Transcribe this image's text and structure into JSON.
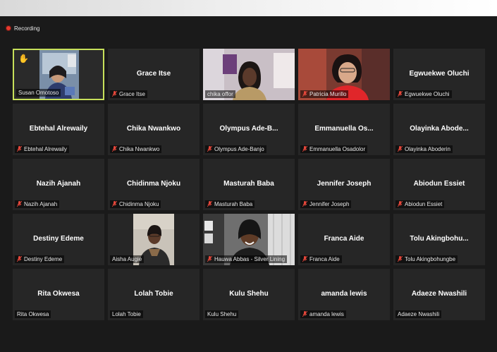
{
  "recording": {
    "label": "Recording"
  },
  "participants": [
    {
      "id": "t0",
      "display": "",
      "label": "Susan Omotoso",
      "muted": false,
      "video": true,
      "active": true,
      "hand": true
    },
    {
      "id": "t1",
      "display": "Grace Itse",
      "label": "Grace Itse",
      "muted": true,
      "video": false
    },
    {
      "id": "t2",
      "display": "",
      "label": "chika offor",
      "muted": false,
      "video": true
    },
    {
      "id": "t3",
      "display": "",
      "label": "Patricia Murillo",
      "muted": true,
      "video": true
    },
    {
      "id": "t4",
      "display": "Egwuekwe Oluchi",
      "label": "Egwuekwe Oluchi",
      "muted": true,
      "video": false
    },
    {
      "id": "t5",
      "display": "Ebtehal Alrewaily",
      "label": "Ebtehal Alrewaily",
      "muted": true,
      "video": false
    },
    {
      "id": "t6",
      "display": "Chika Nwankwo",
      "label": "Chika Nwankwo",
      "muted": true,
      "video": false
    },
    {
      "id": "t7",
      "display": "Olympus Ade-B...",
      "label": "Olympus Ade-Banjo",
      "muted": true,
      "video": false
    },
    {
      "id": "t8",
      "display": "Emmanuella Os...",
      "label": "Emmanuella Osadolor",
      "muted": true,
      "video": false
    },
    {
      "id": "t9",
      "display": "Olayinka Abode...",
      "label": "Olayinka Aboderin",
      "muted": true,
      "video": false
    },
    {
      "id": "t10",
      "display": "Nazih Ajanah",
      "label": "Nazih Ajanah",
      "muted": true,
      "video": false
    },
    {
      "id": "t11",
      "display": "Chidinma Njoku",
      "label": "Chidinma Njoku",
      "muted": true,
      "video": false
    },
    {
      "id": "t12",
      "display": "Masturah Baba",
      "label": "Masturah Baba",
      "muted": true,
      "video": false
    },
    {
      "id": "t13",
      "display": "Jennifer Joseph",
      "label": "Jennifer Joseph",
      "muted": true,
      "video": false
    },
    {
      "id": "t14",
      "display": "Abiodun Essiet",
      "label": "Abiodun Essiet",
      "muted": true,
      "video": false
    },
    {
      "id": "t15",
      "display": "Destiny Edeme",
      "label": "Destiny Edeme",
      "muted": true,
      "video": false
    },
    {
      "id": "t16",
      "display": "",
      "label": "Aisha Augie",
      "muted": false,
      "video": true
    },
    {
      "id": "t17",
      "display": "",
      "label": "Hauwa Abbas - Silver Lining",
      "muted": true,
      "video": true
    },
    {
      "id": "t18",
      "display": "Franca Aide",
      "label": "Franca Aide",
      "muted": true,
      "video": false
    },
    {
      "id": "t19",
      "display": "Tolu  Akingbohu...",
      "label": "Tolu Akingbohungbe",
      "muted": true,
      "video": false
    },
    {
      "id": "t20",
      "display": "Rita Okwesa",
      "label": "Rita Okwesa",
      "muted": false,
      "video": false
    },
    {
      "id": "t21",
      "display": "Lolah Tobie",
      "label": "Lolah Tobie",
      "muted": false,
      "video": false
    },
    {
      "id": "t22",
      "display": "Kulu Shehu",
      "label": "Kulu Shehu",
      "muted": false,
      "video": false
    },
    {
      "id": "t23",
      "display": "amanda lewis",
      "label": "amanda lewis",
      "muted": true,
      "video": false
    },
    {
      "id": "t24",
      "display": "Adaeze Nwashili",
      "label": "Adaeze Nwashili",
      "muted": false,
      "video": false
    }
  ],
  "colors": {
    "active_border": "#c7e05a",
    "muted_icon": "#e5473b",
    "tile_bg": "#262626",
    "recording_dot": "#e8392e"
  }
}
